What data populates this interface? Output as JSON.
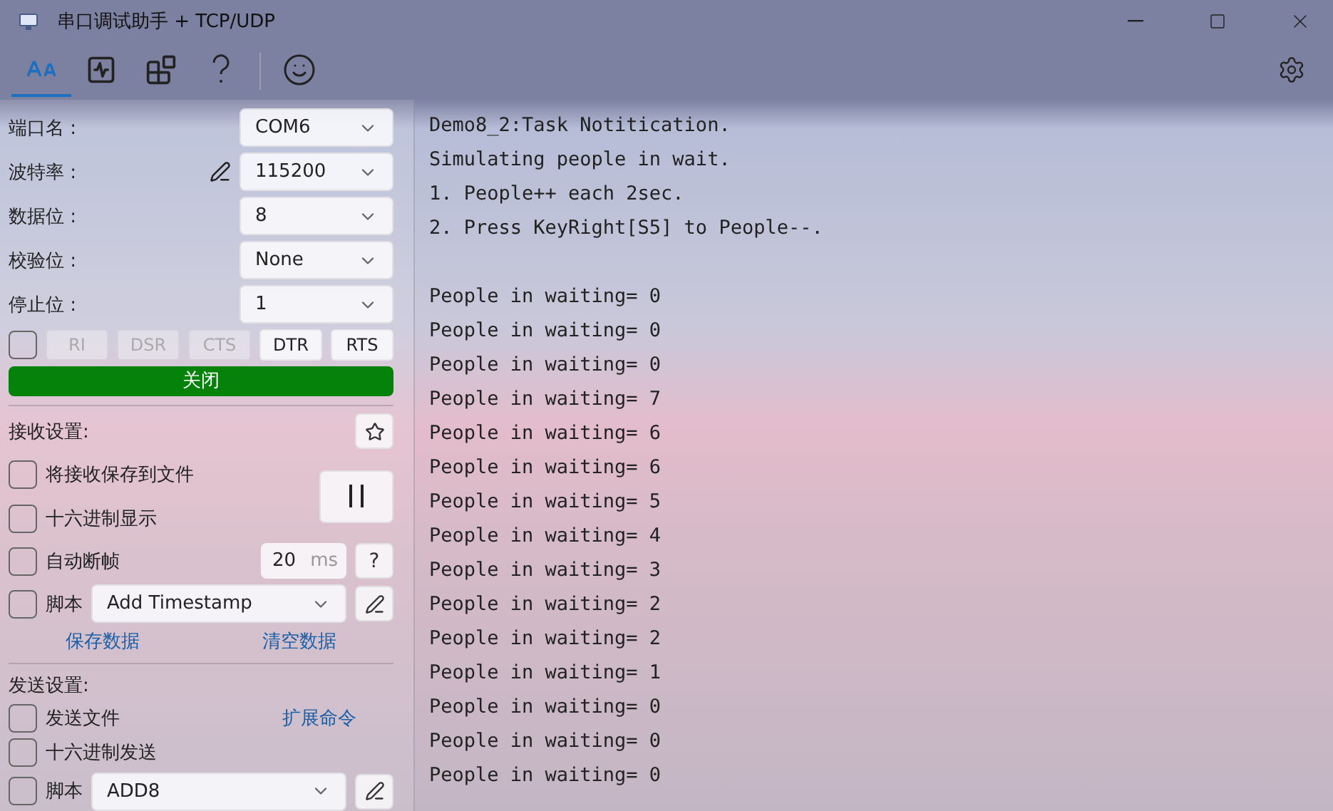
{
  "window": {
    "title": "串口调试助手 + TCP/UDP"
  },
  "toolbar": {
    "tools": [
      {
        "kind": "font",
        "selected": true
      },
      {
        "kind": "chart",
        "selected": false
      },
      {
        "kind": "plugin",
        "selected": false
      },
      {
        "kind": "help",
        "selected": false
      },
      {
        "kind": "smiley",
        "selected": false
      }
    ]
  },
  "port": {
    "fields": [
      {
        "label": "端口名 :",
        "value": "COM6",
        "editable": false
      },
      {
        "label": "波特率 :",
        "value": "115200",
        "editable": true
      },
      {
        "label": "数据位 :",
        "value": "8",
        "editable": false
      },
      {
        "label": "校验位 :",
        "value": "None",
        "editable": false
      },
      {
        "label": "停止位 :",
        "value": "1",
        "editable": false
      }
    ],
    "flow_checked": false,
    "signals": [
      {
        "label": "RI",
        "disabled": true
      },
      {
        "label": "DSR",
        "disabled": true
      },
      {
        "label": "CTS",
        "disabled": true
      },
      {
        "label": "DTR",
        "disabled": false
      },
      {
        "label": "RTS",
        "disabled": false
      }
    ],
    "open_button": "关闭"
  },
  "receive": {
    "title": "接收设置:",
    "options": [
      {
        "label": "将接收保存到文件",
        "checked": false
      },
      {
        "label": "十六进制显示",
        "checked": false
      }
    ],
    "auto_frame": {
      "label": "自动断帧",
      "checked": false,
      "value": "20",
      "unit": "ms",
      "help": "?"
    },
    "script": {
      "label": "脚本",
      "checked": false,
      "value": "Add Timestamp"
    },
    "links": [
      "保存数据",
      "清空数据"
    ]
  },
  "send": {
    "title": "发送设置:",
    "file": {
      "label": "发送文件",
      "checked": false
    },
    "link": "扩展命令",
    "hex": {
      "label": "十六进制发送",
      "checked": false
    },
    "script": {
      "label": "脚本",
      "checked": false,
      "value": "ADD8"
    }
  },
  "terminal": {
    "header": [
      "Demo8_2:Task Notitication.",
      "Simulating people in wait.",
      "1. People++ each 2sec.",
      "2. Press KeyRight[S5] to People--."
    ],
    "lines": [
      "People in waiting= 0",
      "People in waiting= 0",
      "People in waiting= 0",
      "People in waiting= 7",
      "People in waiting= 6",
      "People in waiting= 6",
      "People in waiting= 5",
      "People in waiting= 4",
      "People in waiting= 3",
      "People in waiting= 2",
      "People in waiting= 2",
      "People in waiting= 1",
      "People in waiting= 0",
      "People in waiting= 0",
      "People in waiting= 0"
    ]
  }
}
